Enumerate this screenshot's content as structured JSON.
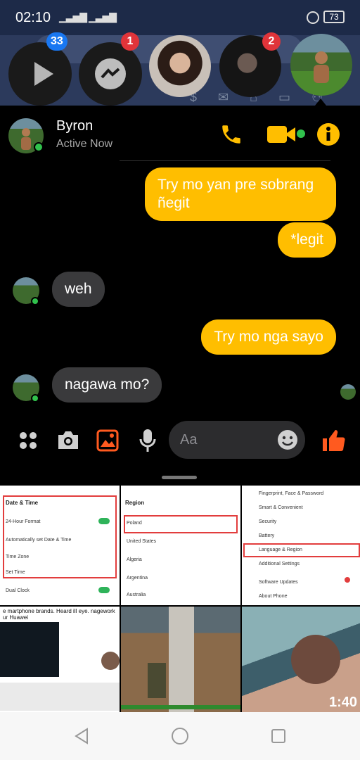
{
  "status_bar": {
    "time": "02:10",
    "battery": "73"
  },
  "chat_heads": [
    {
      "kind": "media-app",
      "badge": "33",
      "badge_color": "#1877f2"
    },
    {
      "kind": "messenger",
      "badge": "1",
      "badge_color": "#e0343a"
    },
    {
      "kind": "contact"
    },
    {
      "kind": "contact",
      "badge": "2",
      "badge_color": "#e0343a"
    },
    {
      "kind": "contact-active"
    }
  ],
  "chat": {
    "contact_name": "Byron",
    "status": "Active Now",
    "accent": "#ffbe00",
    "messages": [
      {
        "dir": "out",
        "text": "Try mo yan pre sobrang ñegit"
      },
      {
        "dir": "out",
        "text": "*legit"
      },
      {
        "dir": "in",
        "text": "weh"
      },
      {
        "dir": "out",
        "text": "Try mo nga sayo"
      },
      {
        "dir": "in",
        "text": "nagawa mo?"
      }
    ]
  },
  "composer": {
    "placeholder": "Aa",
    "accent": "#ff5a1f"
  },
  "gallery": {
    "tiles": [
      {
        "type": "screenshot",
        "title": "Date & Time",
        "rows": [
          "24-Hour Format",
          "Automatically set Date & Time",
          "Time Zone",
          "Set Time",
          "Dual Clock"
        ]
      },
      {
        "type": "screenshot",
        "title": "Region",
        "rows": [
          "Poland",
          "United States",
          "Algeria",
          "Argentina",
          "Australia"
        ]
      },
      {
        "type": "screenshot",
        "title": "",
        "rows": [
          "Fingerprint, Face & Password",
          "Smart & Convenient",
          "Security",
          "Battery",
          "Language & Region",
          "Additional Settings",
          "Software Updates",
          "About Phone"
        ]
      },
      {
        "type": "screenshot",
        "caption": "e martphone brands. Heard ill eye. nagework ur Huawei"
      },
      {
        "type": "photo"
      },
      {
        "type": "video",
        "duration": "1:40"
      }
    ]
  }
}
